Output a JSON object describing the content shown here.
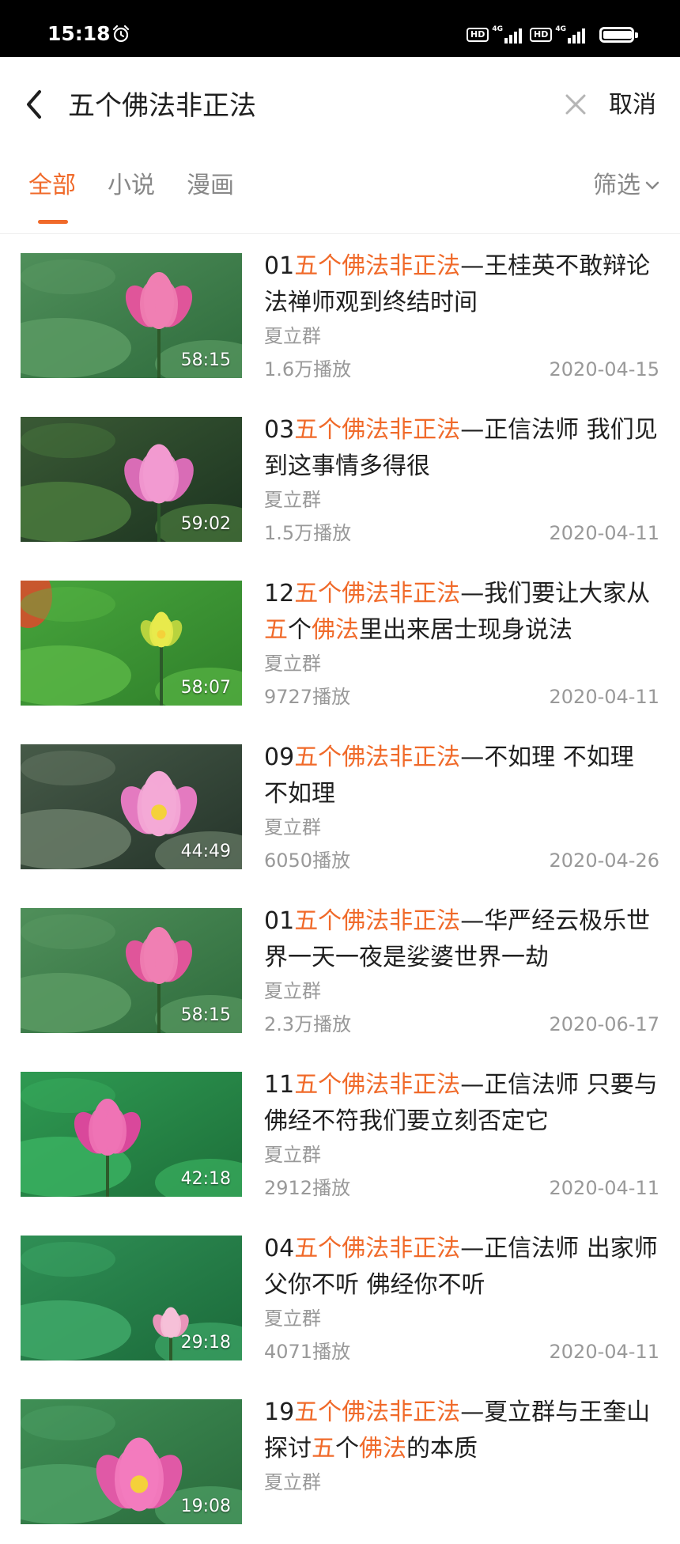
{
  "status_bar": {
    "time": "15:18",
    "alarm_icon": "alarm-clock-icon",
    "sim1": {
      "badge": "HD",
      "network": "4G"
    },
    "sim2": {
      "badge": "HD",
      "network": "4G"
    },
    "battery_level": 0.95
  },
  "search": {
    "back_icon": "chevron-left-icon",
    "query": "五个佛法非正法",
    "clear_icon": "close-icon",
    "cancel_label": "取消"
  },
  "tabs": {
    "items": [
      {
        "label": "全部",
        "active": true
      },
      {
        "label": "小说",
        "active": false
      },
      {
        "label": "漫画",
        "active": false
      }
    ],
    "filter_label": "筛选",
    "filter_icon": "chevron-down-icon"
  },
  "colors": {
    "accent": "#f06a2a",
    "text": "#1f1f1f",
    "muted": "#999999",
    "status_bar": "#000000"
  },
  "results": [
    {
      "title_segments": [
        [
          "01",
          false
        ],
        [
          "五个佛法非正法",
          true
        ],
        [
          "—王桂英不敢辩论 法禅师观到终结时间",
          false
        ]
      ],
      "author": "夏立群",
      "plays": "1.6万播放",
      "date": "2020-04-15",
      "duration": "58:15",
      "thumbnail": "pink-lotus-tall"
    },
    {
      "title_segments": [
        [
          "03",
          false
        ],
        [
          "五个佛法非正法",
          true
        ],
        [
          "—正信法师 我们见到这事情多得很",
          false
        ]
      ],
      "author": "夏立群",
      "plays": "1.5万播放",
      "date": "2020-04-11",
      "duration": "59:02",
      "thumbnail": "pink-lotus-dark"
    },
    {
      "title_segments": [
        [
          "12",
          false
        ],
        [
          "五个佛法非正法",
          true
        ],
        [
          "—我们要让大家从",
          false
        ],
        [
          "五",
          true
        ],
        [
          "个",
          false
        ],
        [
          "佛法",
          true
        ],
        [
          "里出来居士现身说法",
          false
        ]
      ],
      "author": "夏立群",
      "plays": "9727播放",
      "date": "2020-04-11",
      "duration": "58:07",
      "thumbnail": "lotus-seedpod"
    },
    {
      "title_segments": [
        [
          "09",
          false
        ],
        [
          "五个佛法非正法",
          true
        ],
        [
          "—不如理 不如理 不如理",
          false
        ]
      ],
      "author": "夏立群",
      "plays": "6050播放",
      "date": "2020-04-26",
      "duration": "44:49",
      "thumbnail": "pink-lotus-open"
    },
    {
      "title_segments": [
        [
          "01",
          false
        ],
        [
          "五个佛法非正法",
          true
        ],
        [
          "—华严经云极乐世界一天一夜是娑婆世界一劫",
          false
        ]
      ],
      "author": "夏立群",
      "plays": "2.3万播放",
      "date": "2020-06-17",
      "duration": "58:15",
      "thumbnail": "pink-lotus-tall"
    },
    {
      "title_segments": [
        [
          "11",
          false
        ],
        [
          "五个佛法非正法",
          true
        ],
        [
          "—正信法师 只要与佛经不符我们要立刻否定它",
          false
        ]
      ],
      "author": "夏立群",
      "plays": "2912播放",
      "date": "2020-04-11",
      "duration": "42:18",
      "thumbnail": "pink-lotus-leaves"
    },
    {
      "title_segments": [
        [
          "04",
          false
        ],
        [
          "五个佛法非正法",
          true
        ],
        [
          "—正信法师 出家师父你不听 佛经你不听",
          false
        ]
      ],
      "author": "夏立群",
      "plays": "4071播放",
      "date": "2020-04-11",
      "duration": "29:18",
      "thumbnail": "lotus-bud-leaves"
    },
    {
      "title_segments": [
        [
          "19",
          false
        ],
        [
          "五个佛法非正法",
          true
        ],
        [
          "—夏立群与王奎山探讨",
          false
        ],
        [
          "五",
          true
        ],
        [
          "个",
          false
        ],
        [
          "佛法",
          true
        ],
        [
          "的本质",
          false
        ]
      ],
      "author": "夏立群",
      "plays": "",
      "date": "",
      "duration": "19:08",
      "thumbnail": "pink-lotus-full"
    }
  ]
}
